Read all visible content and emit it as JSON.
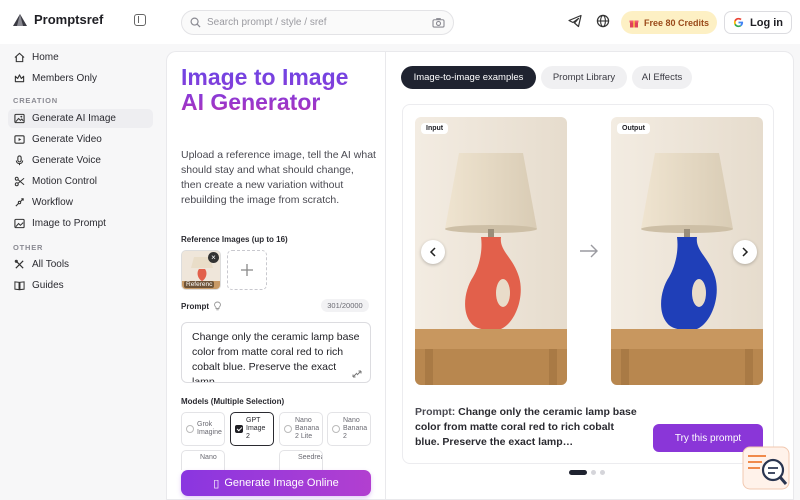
{
  "brand": {
    "name": "Promptsref"
  },
  "search": {
    "placeholder": "Search prompt / style / sref"
  },
  "header": {
    "credits_label": "Free 80 Credits",
    "login_label": "Log in"
  },
  "sidebar": {
    "items_top": [
      {
        "label": "Home",
        "icon": "home-icon"
      },
      {
        "label": "Members Only",
        "icon": "crown-icon"
      }
    ],
    "creation_label": "CREATION",
    "creation": [
      {
        "label": "Generate AI Image",
        "icon": "image-icon",
        "active": true
      },
      {
        "label": "Generate Video",
        "icon": "video-icon"
      },
      {
        "label": "Generate Voice",
        "icon": "mic-icon"
      },
      {
        "label": "Motion Control",
        "icon": "motion-icon"
      },
      {
        "label": "Workflow",
        "icon": "workflow-icon"
      },
      {
        "label": "Image to Prompt",
        "icon": "image-prompt-icon"
      }
    ],
    "other_label": "OTHER",
    "other": [
      {
        "label": "All Tools",
        "icon": "tools-icon"
      },
      {
        "label": "Guides",
        "icon": "book-icon"
      }
    ]
  },
  "left": {
    "title": "Image to Image AI Generator",
    "description": "Upload a reference image, tell the AI what should stay and what should change, then create a new variation without rebuilding the image from scratch.",
    "ref_label": "Reference Images (up to 16)",
    "ref_caption": "Referenc",
    "prompt_label": "Prompt",
    "counter": "301/20000",
    "prompt_value": "Change only the ceramic lamp base color from matte coral red to rich cobalt blue. Preserve the exact lamp",
    "models_label": "Models (Multiple Selection)",
    "models": [
      {
        "label": "Grok Imagine",
        "selected": false
      },
      {
        "label": "GPT Image 2",
        "selected": true
      },
      {
        "label": "Nano Banana 2 Lite",
        "selected": false
      },
      {
        "label": "Nano Banana 2",
        "selected": false
      }
    ],
    "models_row2": [
      "Nano",
      "Seedream"
    ],
    "generate_label": "Generate Image Online"
  },
  "right": {
    "tabs": [
      {
        "label": "Image-to-image examples",
        "active": true
      },
      {
        "label": "Prompt Library",
        "active": false
      },
      {
        "label": "AI Effects",
        "active": false
      }
    ],
    "input_tag": "Input",
    "output_tag": "Output",
    "prompt_prefix": "Prompt:",
    "prompt_text": "Change only the ceramic lamp base color from matte coral red to rich cobalt blue. Preserve the exact lamp…",
    "try_label": "Try this prompt",
    "colors": {
      "input_lamp": "#e2604b",
      "output_lamp": "#1f3fb8",
      "accent": "#8a36d8"
    }
  }
}
